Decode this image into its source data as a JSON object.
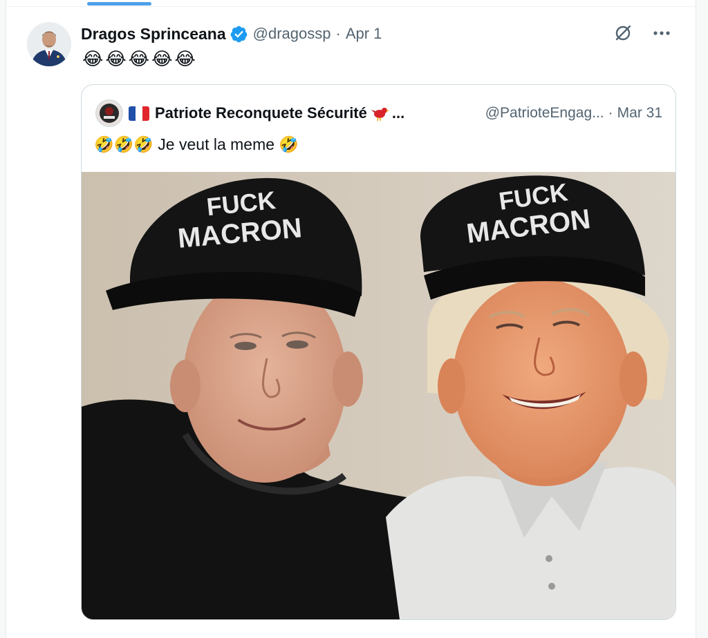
{
  "tweet": {
    "author_name": "Dragos Sprinceana",
    "verified": true,
    "handle": "@dragossp",
    "separator": "·",
    "date": "Apr 1",
    "text": "😂😂😂😂😂"
  },
  "quoted_tweet": {
    "author_name": "Patriote Reconquete Sécurité",
    "ellipsis": "...",
    "handle": "@PatrioteEngag...",
    "separator": "·",
    "date": "Mar 31",
    "text": "🤣🤣🤣 Je veut la meme 🤣",
    "image": {
      "cap_left_line1": "FUCK",
      "cap_left_line2": "MACRON",
      "cap_right_line1": "FUCK",
      "cap_right_line2": "MACRON"
    }
  },
  "icons": {
    "verified": "verified-badge-icon",
    "flag": "france-flag-icon",
    "bird": "red-bird-icon",
    "grok": "grok-icon",
    "more": "more-icon"
  },
  "colors": {
    "accent": "#1d9bf0",
    "secondary_text": "#536471",
    "border": "#cfd9de"
  }
}
